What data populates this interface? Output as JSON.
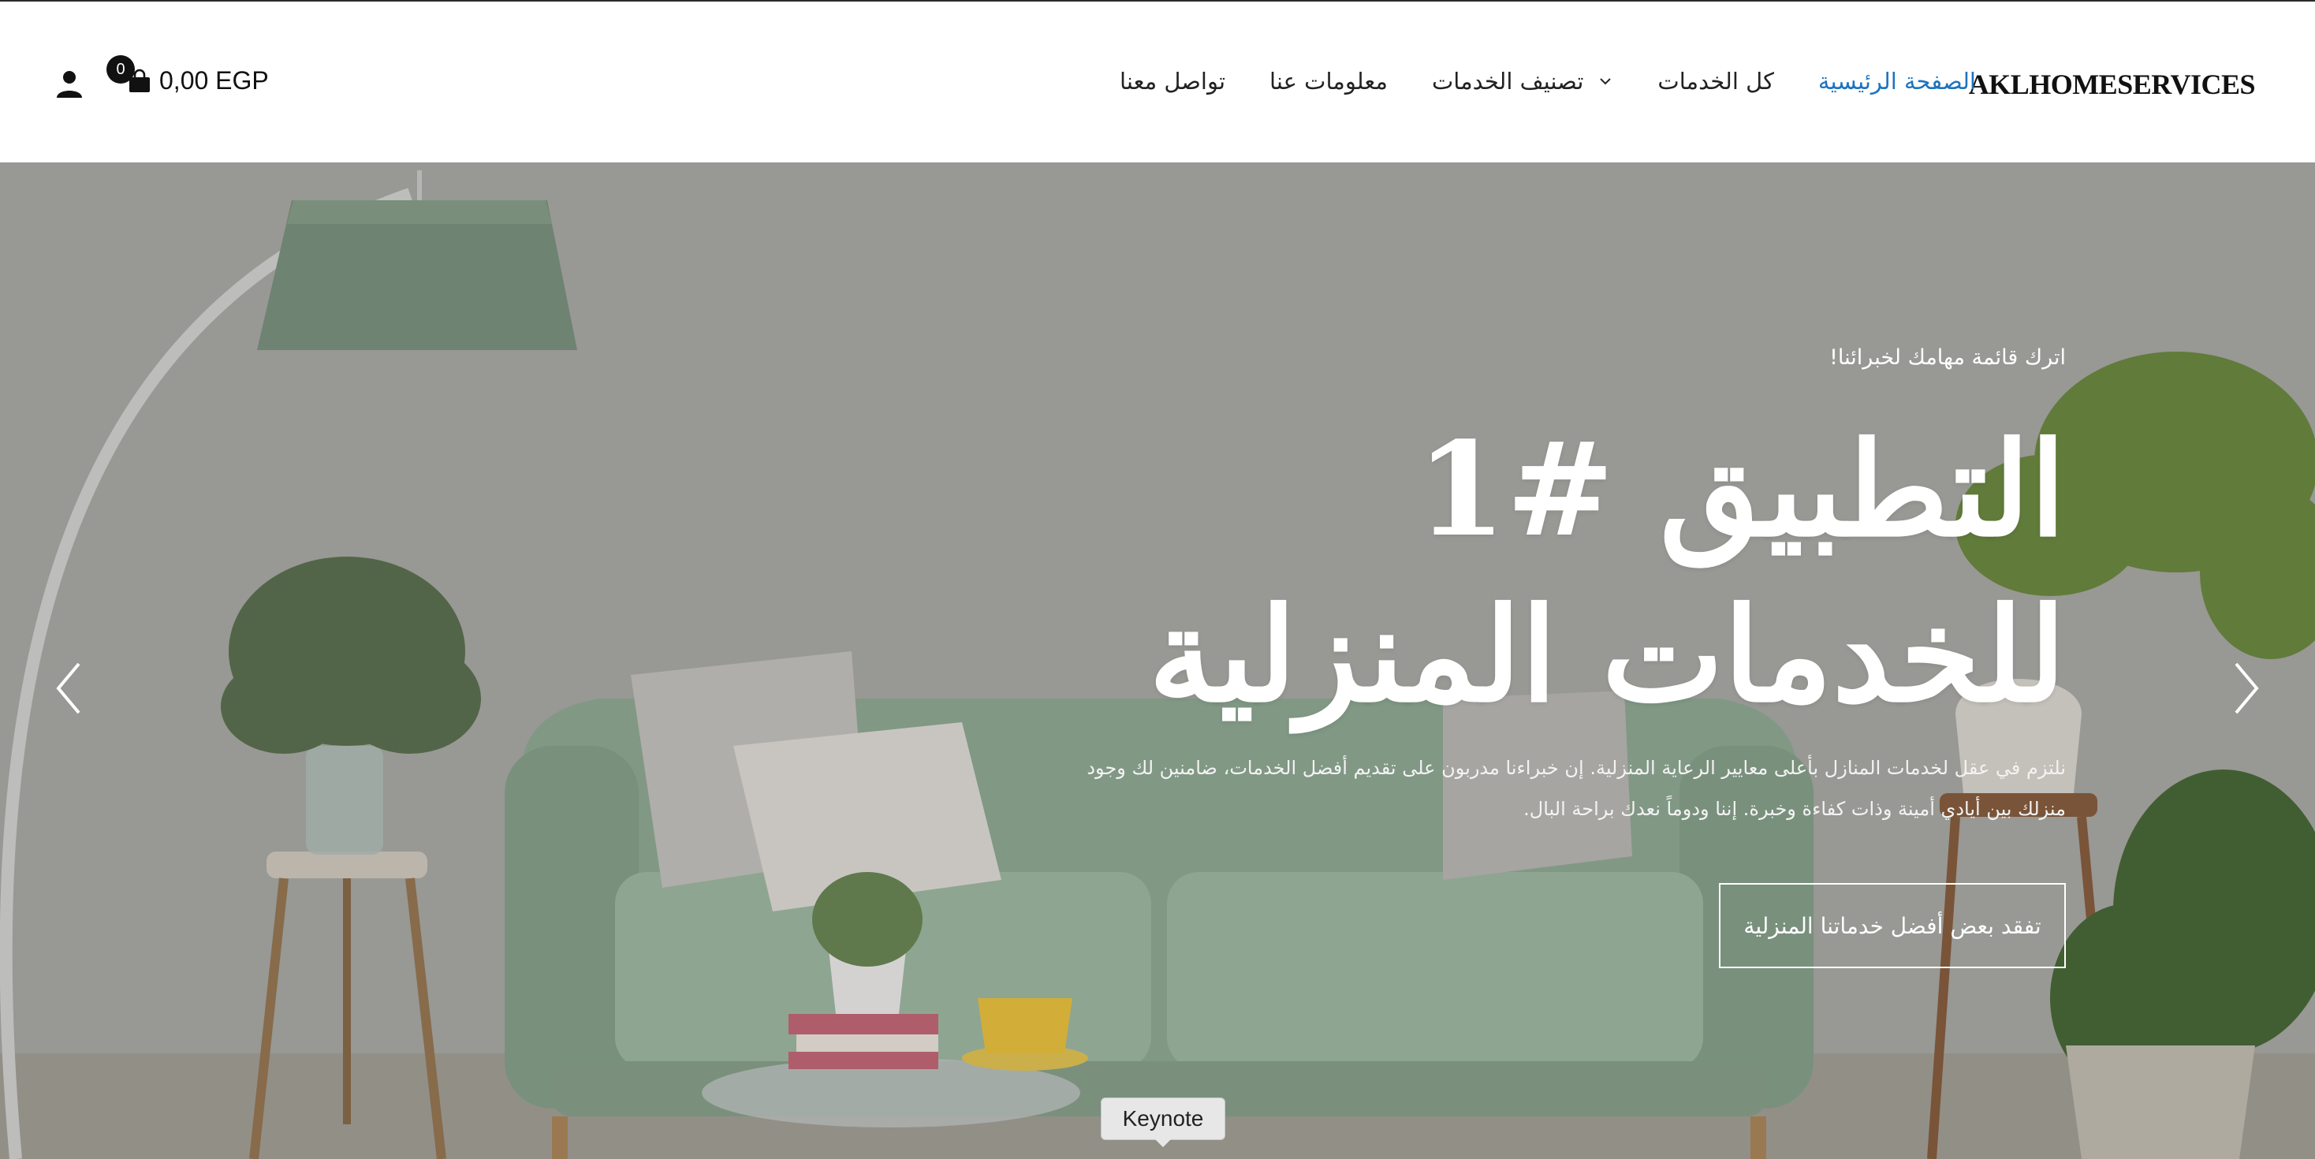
{
  "brand": {
    "logo": "AKLHOMESERVICES"
  },
  "nav": {
    "items": [
      {
        "label": "الصفحة الرئيسية",
        "active": true
      },
      {
        "label": "كل الخدمات"
      },
      {
        "label": "تصنيف الخدمات",
        "has_dropdown": true
      },
      {
        "label": "معلومات عنا"
      },
      {
        "label": "تواصل معنا"
      }
    ]
  },
  "cart": {
    "count": "0",
    "total": "0,00 EGP",
    "icon": "shopping-bag-icon"
  },
  "account": {
    "icon": "user-icon"
  },
  "hero": {
    "eyebrow": "اترك قائمة مهامك لخبرائنا!",
    "title_line1": "التطبيق #1",
    "title_line2": "للخدمات المنزلية",
    "description": "نلتزم في عقل لخدمات المنازل بأعلى معايير الرعاية المنزلية. إن خبراءنا مدربون على تقديم أفضل الخدمات، ضامنين لك وجود منزلك بين أيادي أمينة وذات كفاءة وخبرة. إننا ودوماً نعدك براحة البال.",
    "cta_label": "تفقد بعض أفضل خدماتنا المنزلية"
  },
  "slider": {
    "prev_icon": "chevron-left-icon",
    "next_icon": "chevron-right-icon"
  },
  "tooltip": {
    "label": "Keynote"
  },
  "colors": {
    "accent": "#1e73be",
    "text": "#222222",
    "hero_bg": "#aeada9",
    "sofa": "#9bb3a0"
  }
}
